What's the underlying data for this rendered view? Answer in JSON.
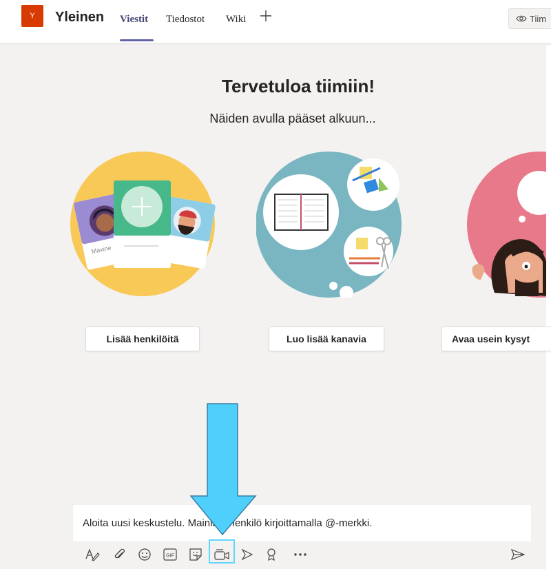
{
  "header": {
    "team_initial": "Y",
    "channel_name": "Yleinen",
    "tabs": [
      {
        "label": "Viestit",
        "active": true
      },
      {
        "label": "Tiedostot",
        "active": false
      },
      {
        "label": "Wiki",
        "active": false
      }
    ],
    "team_button_label": "Tiim"
  },
  "welcome": {
    "title": "Tervetuloa tiimiin!",
    "subtitle": "Näiden avulla pääset alkuun..."
  },
  "cards": [
    {
      "label": "Lisää henkilöitä",
      "illustration_names": [
        "Maxine",
        "ky"
      ]
    },
    {
      "label": "Luo lisää kanavia"
    },
    {
      "label": "Avaa usein kysyt"
    }
  ],
  "composer": {
    "placeholder": "Aloita uusi keskustelu. Mainitse henkilö kirjoittamalla @-merkki.",
    "tools": [
      "format-icon",
      "attach-icon",
      "emoji-icon",
      "gif-icon",
      "sticker-icon",
      "meet-now-icon",
      "stream-icon",
      "praise-icon",
      "more-options-icon",
      "send-icon"
    ],
    "gif_text": "GIF"
  },
  "colors": {
    "accent": "#6264a7",
    "team_avatar": "#d83b01",
    "annotation_arrow": "#4fd0fc",
    "card1_bg": "#f9c958",
    "card2_bg": "#79b6c1",
    "card3_bg": "#e7798a"
  }
}
